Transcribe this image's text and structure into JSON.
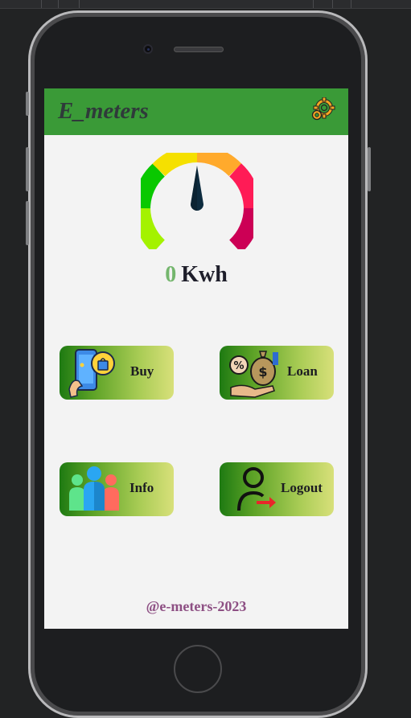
{
  "app": {
    "title": "E_meters"
  },
  "reading": {
    "value": "0",
    "unit": "Kwh"
  },
  "menu": {
    "buy": "Buy",
    "loan": "Loan",
    "info": "Info",
    "logout": "Logout"
  },
  "footer": {
    "text": "@e-meters-2023"
  },
  "icons": {
    "settings": "gear-icon",
    "buy": "mobile-shopping-icon",
    "loan": "money-bag-hand-icon",
    "info": "people-group-icon",
    "logout": "user-logout-icon"
  },
  "colors": {
    "header": "#3a9a37",
    "gauge": [
      "#a4f200",
      "#09c800",
      "#f5e000",
      "#ffaa2c",
      "#ff1b56",
      "#cc0055"
    ],
    "tile_start": "#1e7a12",
    "tile_end": "#d8e07a",
    "footer": "#8d4f83"
  }
}
